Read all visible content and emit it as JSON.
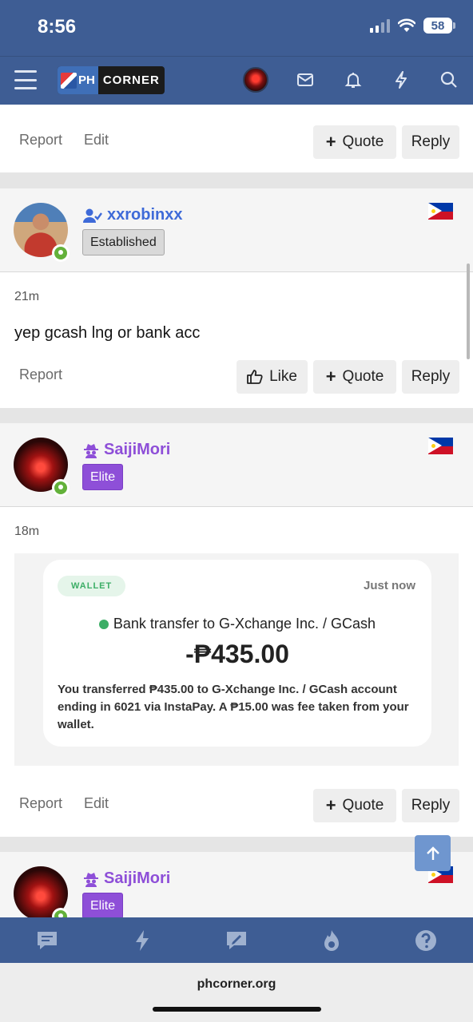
{
  "status_bar": {
    "time": "8:56",
    "battery": "58"
  },
  "header": {
    "logo_left": "PH",
    "logo_right": "CORNER"
  },
  "posts": [
    {
      "actions": {
        "report": "Report",
        "edit": "Edit",
        "quote": "Quote",
        "reply": "Reply"
      }
    },
    {
      "username": "xxrobinxx",
      "badge": "Established",
      "time": "21m",
      "message": "yep gcash lng or bank acc",
      "actions": {
        "report": "Report",
        "like": "Like",
        "quote": "Quote",
        "reply": "Reply"
      }
    },
    {
      "username": "SaijiMori",
      "badge": "Elite",
      "time": "18m",
      "wallet": {
        "tag": "WALLET",
        "time": "Just now",
        "title": "Bank transfer to G-Xchange Inc. / GCash",
        "amount": "-₱435.00",
        "description": "You transferred ₱435.00 to G-Xchange Inc. / GCash account ending in 6021 via InstaPay. A ₱15.00 was fee taken from your wallet."
      },
      "actions": {
        "report": "Report",
        "edit": "Edit",
        "quote": "Quote",
        "reply": "Reply"
      }
    },
    {
      "username": "SaijiMori",
      "badge": "Elite"
    }
  ],
  "browser": {
    "url": "phcorner.org"
  },
  "colors": {
    "brand": "#3e5d94",
    "online": "#63b13a",
    "elite": "#8e4fd8",
    "user_blue": "#3e6ad8",
    "wallet_green": "#3cae66"
  }
}
